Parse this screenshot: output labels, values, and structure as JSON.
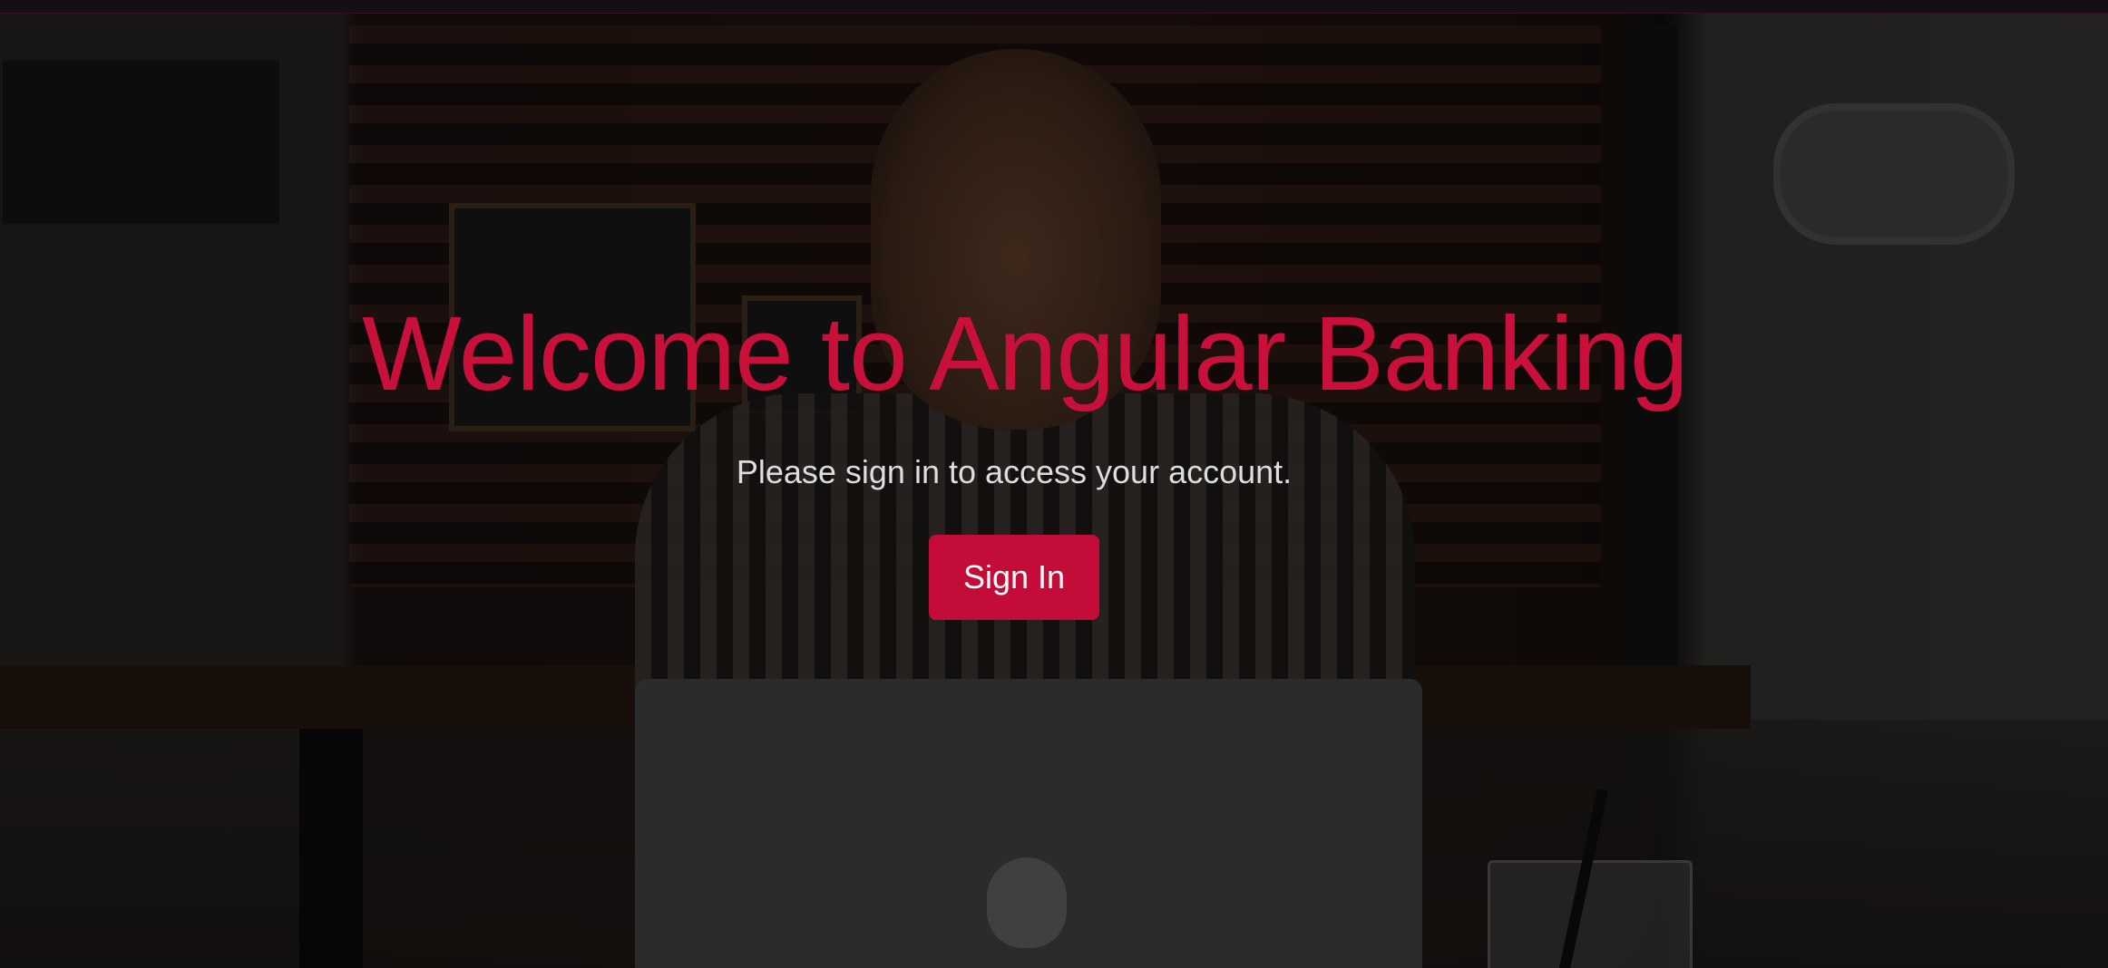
{
  "hero": {
    "title": "Welcome to Angular Banking",
    "subtitle": "Please sign in to access your account.",
    "sign_in_label": "Sign In"
  },
  "colors": {
    "accent": "#c8103a",
    "button_bg": "#c30d38",
    "subtitle_text": "#dedcdc",
    "overlay": "rgba(0,0,0,0.42)"
  },
  "background": {
    "icon": "coffee-shop-photo"
  }
}
